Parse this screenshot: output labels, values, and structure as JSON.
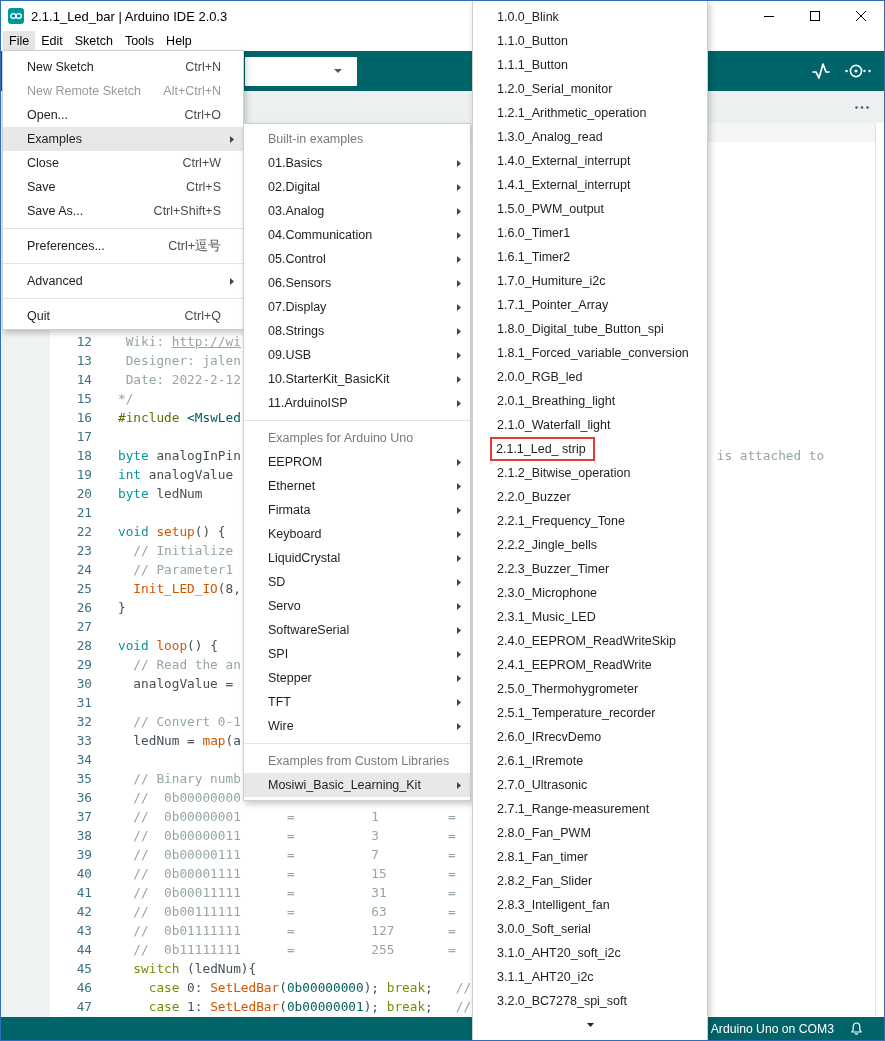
{
  "window": {
    "title": "2.1.1_Led_bar | Arduino IDE 2.0.3"
  },
  "menu_bar": [
    {
      "label": "File",
      "selected": true
    },
    {
      "label": "Edit",
      "selected": false
    },
    {
      "label": "Sketch",
      "selected": false
    },
    {
      "label": "Tools",
      "selected": false
    },
    {
      "label": "Help",
      "selected": false
    }
  ],
  "file_menu": {
    "groups": [
      {
        "items": [
          {
            "label": "New Sketch",
            "shortcut": "Ctrl+N",
            "submenu": false,
            "disabled": false,
            "selected": false
          },
          {
            "label": "New Remote Sketch",
            "shortcut": "Alt+Ctrl+N",
            "submenu": false,
            "disabled": true,
            "selected": false
          },
          {
            "label": "Open...",
            "shortcut": "Ctrl+O",
            "submenu": false,
            "disabled": false,
            "selected": false
          },
          {
            "label": "Examples",
            "submenu": true,
            "disabled": false,
            "selected": true
          },
          {
            "label": "Close",
            "shortcut": "Ctrl+W",
            "submenu": false,
            "disabled": false,
            "selected": false
          },
          {
            "label": "Save",
            "shortcut": "Ctrl+S",
            "submenu": false,
            "disabled": false,
            "selected": false
          },
          {
            "label": "Save As...",
            "shortcut": "Ctrl+Shift+S",
            "submenu": false,
            "disabled": false,
            "selected": false
          }
        ]
      },
      {
        "items": [
          {
            "label": "Preferences...",
            "shortcut": "Ctrl+逗号",
            "submenu": false,
            "disabled": false,
            "selected": false
          }
        ]
      },
      {
        "items": [
          {
            "label": "Advanced",
            "submenu": true,
            "disabled": false,
            "selected": false
          }
        ]
      },
      {
        "items": [
          {
            "label": "Quit",
            "shortcut": "Ctrl+Q",
            "submenu": false,
            "disabled": false,
            "selected": false
          }
        ]
      }
    ]
  },
  "examples_menu": {
    "groups": [
      {
        "heading": "Built-in examples",
        "items": [
          {
            "label": "01.Basics",
            "submenu": true,
            "selected": false
          },
          {
            "label": "02.Digital",
            "submenu": true,
            "selected": false
          },
          {
            "label": "03.Analog",
            "submenu": true,
            "selected": false
          },
          {
            "label": "04.Communication",
            "submenu": true,
            "selected": false
          },
          {
            "label": "05.Control",
            "submenu": true,
            "selected": false
          },
          {
            "label": "06.Sensors",
            "submenu": true,
            "selected": false
          },
          {
            "label": "07.Display",
            "submenu": true,
            "selected": false
          },
          {
            "label": "08.Strings",
            "submenu": true,
            "selected": false
          },
          {
            "label": "09.USB",
            "submenu": true,
            "selected": false
          },
          {
            "label": "10.StarterKit_BasicKit",
            "submenu": true,
            "selected": false
          },
          {
            "label": "11.ArduinoISP",
            "submenu": true,
            "selected": false
          }
        ]
      },
      {
        "heading": "Examples for Arduino Uno",
        "items": [
          {
            "label": "EEPROM",
            "submenu": true,
            "selected": false
          },
          {
            "label": "Ethernet",
            "submenu": true,
            "selected": false
          },
          {
            "label": "Firmata",
            "submenu": true,
            "selected": false
          },
          {
            "label": "Keyboard",
            "submenu": true,
            "selected": false
          },
          {
            "label": "LiquidCrystal",
            "submenu": true,
            "selected": false
          },
          {
            "label": "SD",
            "submenu": true,
            "selected": false
          },
          {
            "label": "Servo",
            "submenu": true,
            "selected": false
          },
          {
            "label": "SoftwareSerial",
            "submenu": true,
            "selected": false
          },
          {
            "label": "SPI",
            "submenu": true,
            "selected": false
          },
          {
            "label": "Stepper",
            "submenu": true,
            "selected": false
          },
          {
            "label": "TFT",
            "submenu": true,
            "selected": false
          },
          {
            "label": "Wire",
            "submenu": true,
            "selected": false
          }
        ]
      },
      {
        "heading": "Examples from Custom Libraries",
        "items": [
          {
            "label": "Mosiwi_Basic_Learning_Kit",
            "submenu": true,
            "selected": true
          }
        ]
      }
    ]
  },
  "sketch_list": {
    "items": [
      {
        "label": "1.0.0_Blink",
        "outlined": false
      },
      {
        "label": "1.1.0_Button",
        "outlined": false
      },
      {
        "label": "1.1.1_Button",
        "outlined": false
      },
      {
        "label": "1.2.0_Serial_monitor",
        "outlined": false
      },
      {
        "label": "1.2.1_Arithmetic_operation",
        "outlined": false
      },
      {
        "label": "1.3.0_Analog_read",
        "outlined": false
      },
      {
        "label": "1.4.0_External_interrupt",
        "outlined": false
      },
      {
        "label": "1.4.1_External_interrupt",
        "outlined": false
      },
      {
        "label": "1.5.0_PWM_output",
        "outlined": false
      },
      {
        "label": "1.6.0_Timer1",
        "outlined": false
      },
      {
        "label": "1.6.1_Timer2",
        "outlined": false
      },
      {
        "label": "1.7.0_Humiture_i2c",
        "outlined": false
      },
      {
        "label": "1.7.1_Pointer_Array",
        "outlined": false
      },
      {
        "label": "1.8.0_Digital_tube_Button_spi",
        "outlined": false
      },
      {
        "label": "1.8.1_Forced_variable_conversion",
        "outlined": false
      },
      {
        "label": "2.0.0_RGB_led",
        "outlined": false
      },
      {
        "label": "2.0.1_Breathing_light",
        "outlined": false
      },
      {
        "label": "2.1.0_Waterfall_light",
        "outlined": false
      },
      {
        "label": "2.1.1_Led_ strip",
        "outlined": true
      },
      {
        "label": "2.1.2_Bitwise_operation",
        "outlined": false
      },
      {
        "label": "2.2.0_Buzzer",
        "outlined": false
      },
      {
        "label": "2.2.1_Frequency_Tone",
        "outlined": false
      },
      {
        "label": "2.2.2_Jingle_bells",
        "outlined": false
      },
      {
        "label": "2.2.3_Buzzer_Timer",
        "outlined": false
      },
      {
        "label": "2.3.0_Microphone",
        "outlined": false
      },
      {
        "label": "2.3.1_Music_LED",
        "outlined": false
      },
      {
        "label": "2.4.0_EEPROM_ReadWriteSkip",
        "outlined": false
      },
      {
        "label": "2.4.1_EEPROM_ReadWrite",
        "outlined": false
      },
      {
        "label": "2.5.0_Thermohygrometer",
        "outlined": false
      },
      {
        "label": "2.5.1_Temperature_recorder",
        "outlined": false
      },
      {
        "label": "2.6.0_IRrecvDemo",
        "outlined": false
      },
      {
        "label": "2.6.1_IRremote",
        "outlined": false
      },
      {
        "label": "2.7.0_Ultrasonic",
        "outlined": false
      },
      {
        "label": "2.7.1_Range-measurement",
        "outlined": false
      },
      {
        "label": "2.8.0_Fan_PWM",
        "outlined": false
      },
      {
        "label": "2.8.1_Fan_timer",
        "outlined": false
      },
      {
        "label": "2.8.2_Fan_Slider",
        "outlined": false
      },
      {
        "label": "2.8.3_Intelligent_fan",
        "outlined": false
      },
      {
        "label": "3.0.0_Soft_serial",
        "outlined": false
      },
      {
        "label": "3.1.0_AHT20_soft_i2c",
        "outlined": false
      },
      {
        "label": "3.1.1_AHT20_i2c",
        "outlined": false
      },
      {
        "label": "3.2.0_BC7278_spi_soft",
        "outlined": false
      }
    ]
  },
  "editor": {
    "lines": [
      {
        "number": "12",
        "tokens": [
          {
            "kind": "comment",
            "text": " Wiki: "
          },
          {
            "kind": "link",
            "text": "http://wi"
          }
        ]
      },
      {
        "number": "13",
        "tokens": [
          {
            "kind": "comment",
            "text": " Designer: jalen"
          }
        ]
      },
      {
        "number": "14",
        "tokens": [
          {
            "kind": "comment",
            "text": " Date: 2022-2-12"
          }
        ]
      },
      {
        "number": "15",
        "tokens": [
          {
            "kind": "comment",
            "text": "*/"
          }
        ]
      },
      {
        "number": "16",
        "tokens": [
          {
            "kind": "preprocessor",
            "text": "#include"
          },
          {
            "kind": "literal",
            "text": " <MswLed"
          }
        ]
      },
      {
        "number": "17"
      },
      {
        "number": "18",
        "tokens": [
          {
            "kind": "keyword",
            "text": "byte"
          },
          {
            "kind": "plain",
            "text": " analogInPin"
          }
        ],
        "trailing": "is attached to"
      },
      {
        "number": "19",
        "tokens": [
          {
            "kind": "keyword",
            "text": "int"
          },
          {
            "kind": "plain",
            "text": " analogValue"
          }
        ]
      },
      {
        "number": "20",
        "tokens": [
          {
            "kind": "keyword",
            "text": "byte"
          },
          {
            "kind": "plain",
            "text": " ledNum"
          }
        ]
      },
      {
        "number": "21"
      },
      {
        "number": "22",
        "tokens": [
          {
            "kind": "keyword",
            "text": "void"
          },
          {
            "kind": "function",
            "text": " setup"
          },
          {
            "kind": "plain",
            "text": "() {"
          }
        ]
      },
      {
        "number": "23",
        "tokens": [
          {
            "kind": "comment",
            "text": "  // Initialize"
          }
        ]
      },
      {
        "number": "24",
        "tokens": [
          {
            "kind": "comment",
            "text": "  // Parameter1"
          }
        ]
      },
      {
        "number": "25",
        "tokens": [
          {
            "kind": "function",
            "text": "  Init_LED_IO"
          },
          {
            "kind": "plain",
            "text": "(8,"
          }
        ]
      },
      {
        "number": "26",
        "tokens": [
          {
            "kind": "plain",
            "text": "}"
          }
        ]
      },
      {
        "number": "27"
      },
      {
        "number": "28",
        "tokens": [
          {
            "kind": "keyword",
            "text": "void"
          },
          {
            "kind": "function",
            "text": " loop"
          },
          {
            "kind": "plain",
            "text": "() {"
          }
        ]
      },
      {
        "number": "29",
        "tokens": [
          {
            "kind": "comment",
            "text": "  // Read the an"
          }
        ]
      },
      {
        "number": "30",
        "tokens": [
          {
            "kind": "plain",
            "text": "  analogValue ="
          }
        ]
      },
      {
        "number": "31"
      },
      {
        "number": "32",
        "tokens": [
          {
            "kind": "comment",
            "text": "  // Convert 0-1"
          }
        ]
      },
      {
        "number": "33",
        "tokens": [
          {
            "kind": "plain",
            "text": "  ledNum = "
          },
          {
            "kind": "function",
            "text": "map"
          },
          {
            "kind": "plain",
            "text": "(a"
          }
        ]
      },
      {
        "number": "34"
      },
      {
        "number": "35",
        "tokens": [
          {
            "kind": "comment",
            "text": "  // Binary numb"
          }
        ]
      },
      {
        "number": "36",
        "tokens": [
          {
            "kind": "comment",
            "text": "  //  0b00000000"
          }
        ]
      },
      {
        "number": "37",
        "tokens": [
          {
            "kind": "comment",
            "text": "  //  0b00000001      =          1         ="
          }
        ]
      },
      {
        "number": "38",
        "tokens": [
          {
            "kind": "comment",
            "text": "  //  0b00000011      =          3         ="
          }
        ]
      },
      {
        "number": "39",
        "tokens": [
          {
            "kind": "comment",
            "text": "  //  0b00000111      =          7         ="
          }
        ]
      },
      {
        "number": "40",
        "tokens": [
          {
            "kind": "comment",
            "text": "  //  0b00001111      =          15        ="
          }
        ]
      },
      {
        "number": "41",
        "tokens": [
          {
            "kind": "comment",
            "text": "  //  0b00011111      =          31        ="
          }
        ]
      },
      {
        "number": "42",
        "tokens": [
          {
            "kind": "comment",
            "text": "  //  0b00111111      =          63        ="
          }
        ]
      },
      {
        "number": "43",
        "tokens": [
          {
            "kind": "comment",
            "text": "  //  0b01111111      =          127       ="
          }
        ]
      },
      {
        "number": "44",
        "tokens": [
          {
            "kind": "comment",
            "text": "  //  0b11111111      =          255       ="
          }
        ]
      },
      {
        "number": "45",
        "tokens": [
          {
            "kind": "control",
            "text": "  switch"
          },
          {
            "kind": "plain",
            "text": " (ledNum){"
          }
        ]
      },
      {
        "number": "46",
        "tokens": [
          {
            "kind": "control",
            "text": "    case"
          },
          {
            "kind": "plain",
            "text": " 0: "
          },
          {
            "kind": "function",
            "text": "SetLedBar"
          },
          {
            "kind": "plain",
            "text": "("
          },
          {
            "kind": "literal",
            "text": "0b00000000"
          },
          {
            "kind": "plain",
            "text": "); "
          },
          {
            "kind": "control",
            "text": "break"
          },
          {
            "kind": "plain",
            "text": ";"
          },
          {
            "kind": "comment",
            "text": "   //"
          }
        ]
      },
      {
        "number": "47",
        "tokens": [
          {
            "kind": "control",
            "text": "    case"
          },
          {
            "kind": "plain",
            "text": " 1: "
          },
          {
            "kind": "function",
            "text": "SetLedBar"
          },
          {
            "kind": "plain",
            "text": "("
          },
          {
            "kind": "literal",
            "text": "0b00000001"
          },
          {
            "kind": "plain",
            "text": "); "
          },
          {
            "kind": "control",
            "text": "break"
          },
          {
            "kind": "plain",
            "text": ";"
          },
          {
            "kind": "comment",
            "text": "   //"
          }
        ]
      }
    ]
  },
  "status_bar": {
    "board": "Arduino Uno on COM3"
  }
}
